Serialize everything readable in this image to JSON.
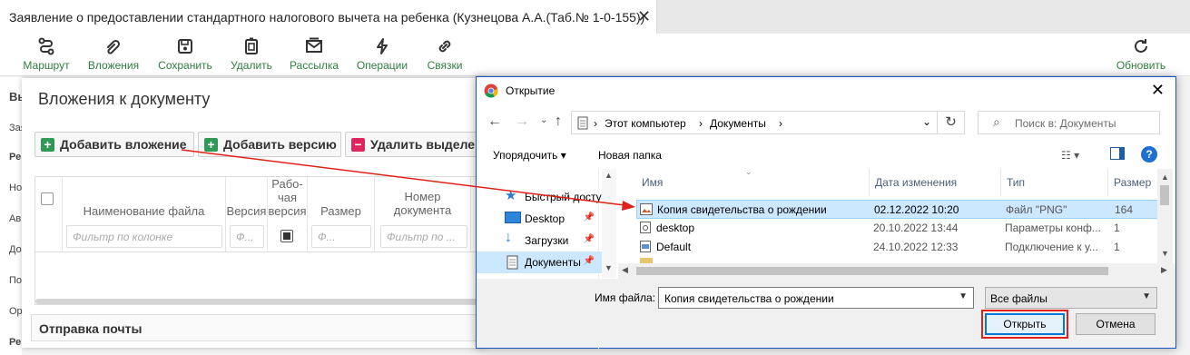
{
  "window": {
    "tab_title": "Заявление о предоставлении стандартного налогового вычета на ребенка (Кузнецова А.А.(Таб.№ 1-0-155))",
    "close": "✕"
  },
  "toolbar": {
    "route": "Маршрут",
    "attachments": "Вложения",
    "save": "Сохранить",
    "delete": "Удалить",
    "mailing": "Рассылка",
    "operations": "Операции",
    "links": "Связки",
    "refresh": "Обновить",
    "label_color": "#2f7f3f"
  },
  "background_labels": [
    "Вы",
    "Зая",
    "Ре",
    "Но",
    "Ав",
    "До",
    "По",
    "Ор",
    "Ре"
  ],
  "attachments": {
    "title": "Вложения к документу",
    "add_attachment": "Добавить вложение",
    "add_version": "Добавить версию",
    "delete_selected": "Удалить выделен",
    "columns": {
      "file_name": "Наименование файла",
      "version": "Версия",
      "working": "Рабо-\nчая\nверсия",
      "size": "Размер",
      "doc_number": "Номер\nдокумента"
    },
    "filter_placeholder": "Фильтр по колонке",
    "filter_short": "Ф...",
    "filter_size": "Ф...",
    "filter_doc": "Фильтр по ...",
    "mail_section": "Отправка почты"
  },
  "dialog": {
    "title": "Открытие",
    "address": {
      "computer": "Этот компьютер",
      "documents": "Документы"
    },
    "search_placeholder": "Поиск в: Документы",
    "organize": "Упорядочить",
    "new_folder": "Новая папка",
    "nav_items": [
      {
        "label": "Быстрый доступ",
        "icon": "star-icon"
      },
      {
        "label": "Desktop",
        "icon": "desktop-folder-icon"
      },
      {
        "label": "Загрузки",
        "icon": "download-icon"
      },
      {
        "label": "Документы",
        "icon": "documents-icon"
      }
    ],
    "columns": {
      "name": "Имя",
      "modified": "Дата изменения",
      "type": "Тип",
      "size": "Размер"
    },
    "files": [
      {
        "name": "Копия свидетельства о рождении",
        "modified": "02.12.2022 10:20",
        "type": "Файл \"PNG\"",
        "size": "164",
        "selected": true
      },
      {
        "name": "desktop",
        "modified": "20.10.2022 13:44",
        "type": "Параметры конф...",
        "size": "1",
        "selected": false
      },
      {
        "name": "Default",
        "modified": "24.10.2022 12:33",
        "type": "Подключение к у...",
        "size": "1",
        "selected": false
      }
    ],
    "filename_label": "Имя файла:",
    "filename_value": "Копия свидетельства о рождении",
    "filetype": "Все файлы",
    "open": "Открыть",
    "cancel": "Отмена"
  },
  "colors": {
    "accent_green": "#2f9a55",
    "danger": "#e0245e",
    "highlight": "#e0201b",
    "selection": "#cce8ff"
  }
}
